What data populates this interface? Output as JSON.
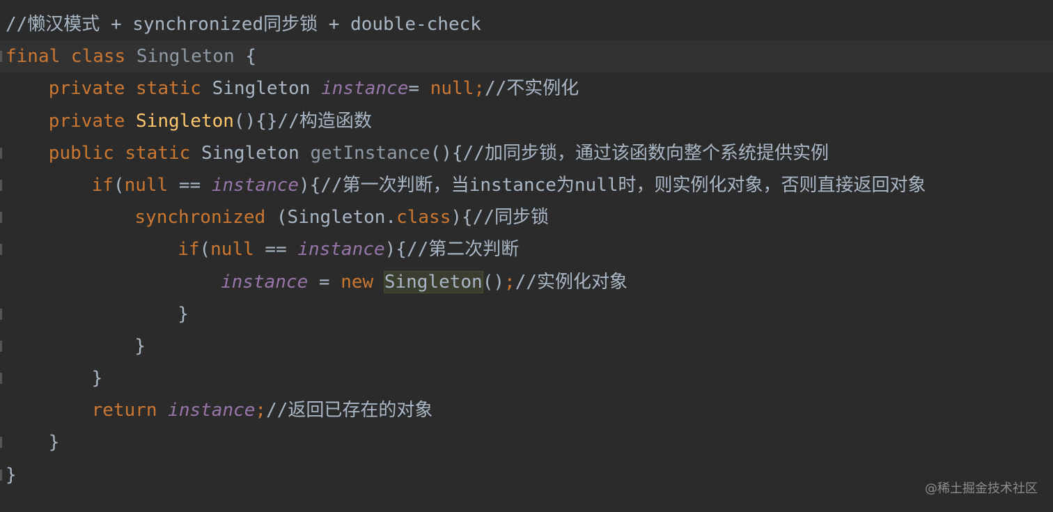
{
  "editor": {
    "lines": [
      {
        "indent": 0,
        "current": false,
        "gutter": false,
        "tokens": [
          {
            "t": "//懒汉模式 + synchronized同步锁 + double-check",
            "k": "comment"
          }
        ]
      },
      {
        "indent": 0,
        "current": true,
        "gutter": true,
        "tokens": [
          {
            "t": "final class ",
            "k": "kw"
          },
          {
            "t": "Singleton",
            "k": "cls-dim"
          },
          {
            "t": " {",
            "k": "punct"
          }
        ]
      },
      {
        "indent": 1,
        "current": false,
        "gutter": false,
        "tokens": [
          {
            "t": "private static ",
            "k": "kw"
          },
          {
            "t": "Singleton ",
            "k": "cls"
          },
          {
            "t": "instance",
            "k": "field"
          },
          {
            "t": "= ",
            "k": "punct"
          },
          {
            "t": "null;",
            "k": "kw"
          },
          {
            "t": "//不实例化",
            "k": "comment"
          }
        ]
      },
      {
        "indent": 1,
        "current": false,
        "gutter": false,
        "tokens": [
          {
            "t": "private ",
            "k": "kw"
          },
          {
            "t": "Singleton",
            "k": "fn"
          },
          {
            "t": "(){}",
            "k": "punct"
          },
          {
            "t": "//构造函数",
            "k": "comment"
          }
        ]
      },
      {
        "indent": 1,
        "current": false,
        "gutter": true,
        "tokens": [
          {
            "t": "public static ",
            "k": "kw"
          },
          {
            "t": "Singleton ",
            "k": "cls"
          },
          {
            "t": "getInstance",
            "k": "method"
          },
          {
            "t": "(){",
            "k": "punct"
          },
          {
            "t": "//加同步锁，通过该函数向整个系统提供实例",
            "k": "comment"
          }
        ]
      },
      {
        "indent": 2,
        "current": false,
        "gutter": true,
        "tokens": [
          {
            "t": "if",
            "k": "kw"
          },
          {
            "t": "(",
            "k": "punct"
          },
          {
            "t": "null",
            "k": "kw"
          },
          {
            "t": " == ",
            "k": "punct"
          },
          {
            "t": "instance",
            "k": "field"
          },
          {
            "t": "){",
            "k": "punct"
          },
          {
            "t": "//第一次判断，当instance为null时，则实例化对象，否则直接返回对象",
            "k": "comment"
          }
        ]
      },
      {
        "indent": 3,
        "current": false,
        "gutter": true,
        "tokens": [
          {
            "t": "synchronized ",
            "k": "kw"
          },
          {
            "t": "(Singleton.",
            "k": "punct"
          },
          {
            "t": "class",
            "k": "kw"
          },
          {
            "t": "){",
            "k": "punct"
          },
          {
            "t": "//同步锁",
            "k": "comment"
          }
        ]
      },
      {
        "indent": 4,
        "current": false,
        "gutter": true,
        "tokens": [
          {
            "t": "if",
            "k": "kw"
          },
          {
            "t": "(",
            "k": "punct"
          },
          {
            "t": "null",
            "k": "kw"
          },
          {
            "t": " == ",
            "k": "punct"
          },
          {
            "t": "instance",
            "k": "field"
          },
          {
            "t": "){",
            "k": "punct"
          },
          {
            "t": "//第二次判断",
            "k": "comment"
          }
        ]
      },
      {
        "indent": 5,
        "current": false,
        "gutter": false,
        "tokens": [
          {
            "t": "instance",
            "k": "field"
          },
          {
            "t": " = ",
            "k": "punct"
          },
          {
            "t": "new ",
            "k": "kw"
          },
          {
            "t": "Singleton",
            "k": "hl"
          },
          {
            "t": "()",
            "k": "punct"
          },
          {
            "t": ";",
            "k": "semi"
          },
          {
            "t": "//实例化对象",
            "k": "comment"
          }
        ]
      },
      {
        "indent": 4,
        "current": false,
        "gutter": true,
        "tokens": [
          {
            "t": "}",
            "k": "punct"
          }
        ]
      },
      {
        "indent": 3,
        "current": false,
        "gutter": true,
        "tokens": [
          {
            "t": "}",
            "k": "punct"
          }
        ]
      },
      {
        "indent": 2,
        "current": false,
        "gutter": true,
        "tokens": [
          {
            "t": "}",
            "k": "punct"
          }
        ]
      },
      {
        "indent": 2,
        "current": false,
        "gutter": false,
        "tokens": [
          {
            "t": "return ",
            "k": "kw"
          },
          {
            "t": "instance",
            "k": "field"
          },
          {
            "t": ";",
            "k": "semi"
          },
          {
            "t": "//返回已存在的对象",
            "k": "comment"
          }
        ]
      },
      {
        "indent": 1,
        "current": false,
        "gutter": true,
        "tokens": [
          {
            "t": "}",
            "k": "punct"
          }
        ]
      },
      {
        "indent": 0,
        "current": false,
        "gutter": true,
        "tokens": [
          {
            "t": "}",
            "k": "punct"
          }
        ]
      }
    ]
  },
  "watermark": "@稀土掘金技术社区",
  "colors": {
    "background": "#2b2b2b",
    "keyword": "#cc7832",
    "field": "#9876aa",
    "method_name": "#ffc66d",
    "text": "#a9b7c6"
  }
}
